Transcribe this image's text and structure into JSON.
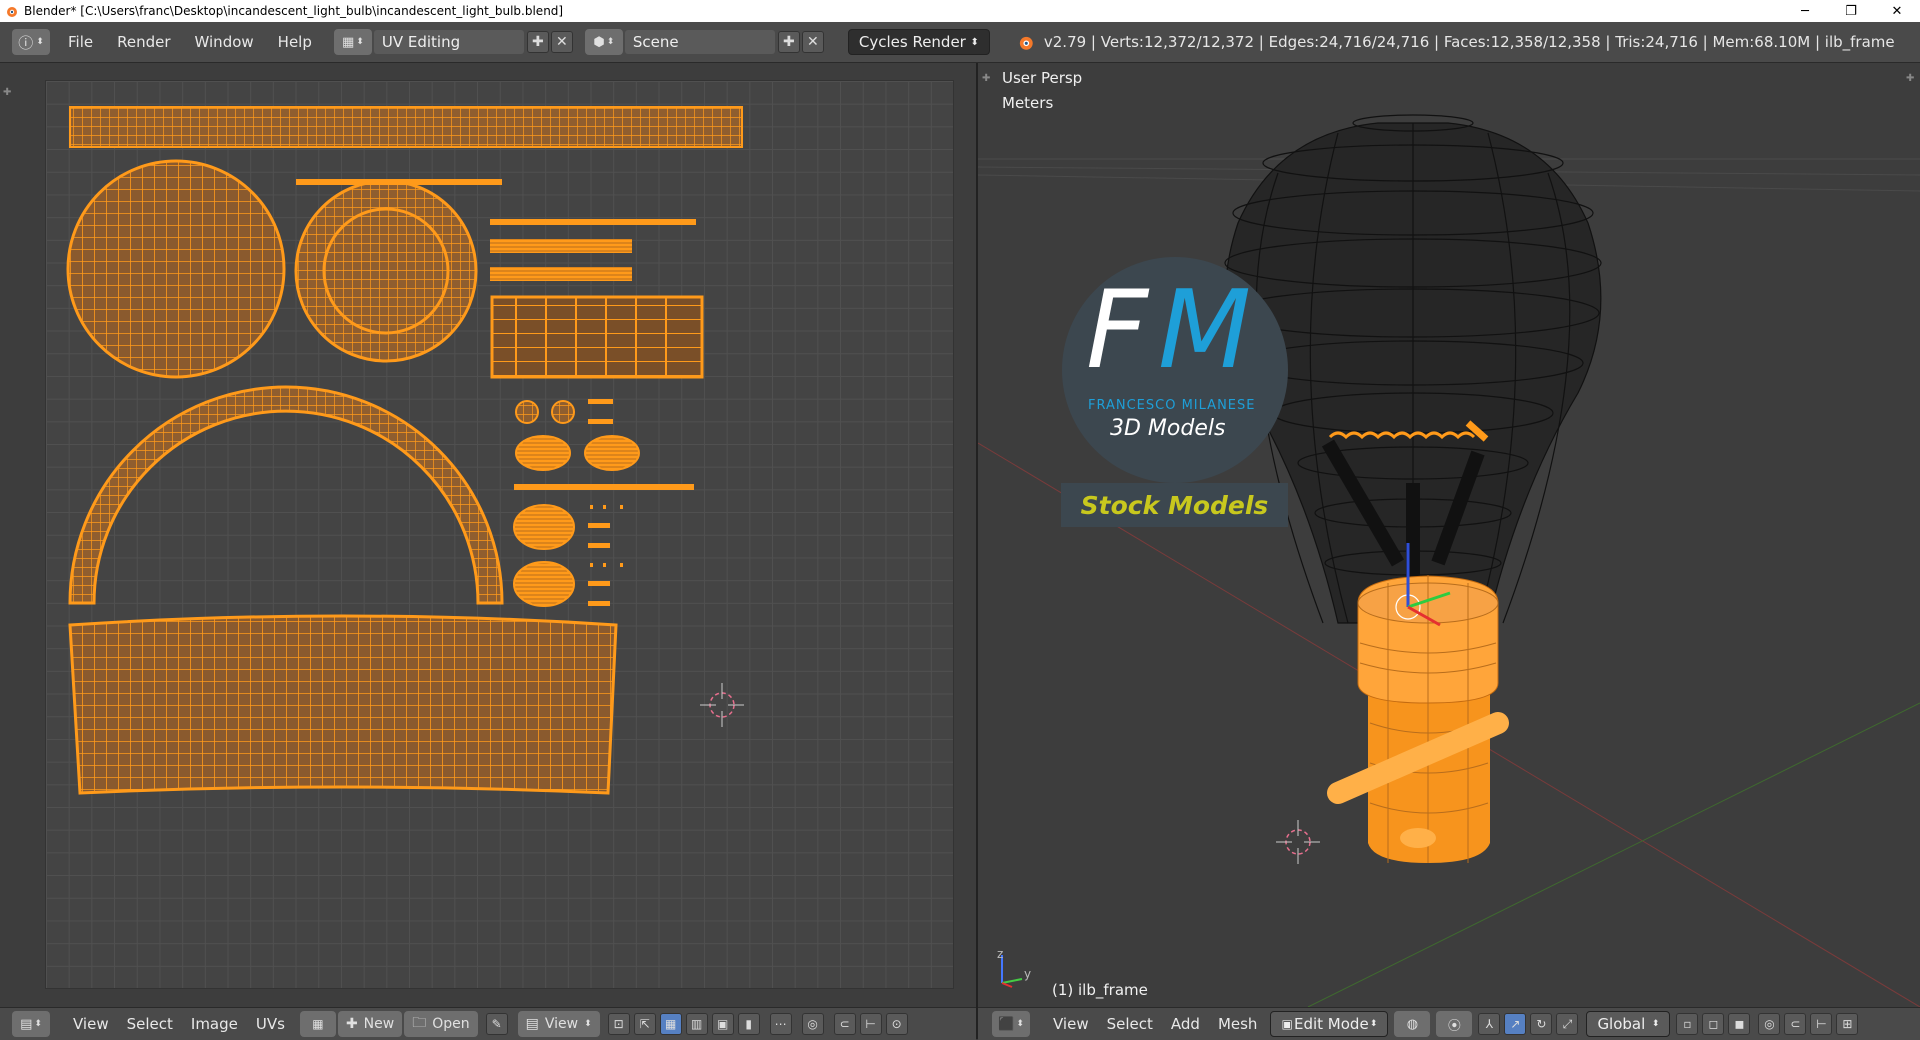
{
  "window": {
    "title": "Blender* [C:\\Users\\franc\\Desktop\\incandescent_light_bulb\\incandescent_light_bulb.blend]",
    "controls": [
      "─",
      "❐",
      "✕"
    ]
  },
  "menu": {
    "file": "File",
    "render": "Render",
    "window": "Window",
    "help": "Help"
  },
  "layout": {
    "value": "UV Editing"
  },
  "scene": {
    "value": "Scene"
  },
  "engine": {
    "value": "Cycles Render"
  },
  "stats": "v2.79 | Verts:12,372/12,372 | Edges:24,716/24,716 | Faces:12,358/12,358 | Tris:24,716 | Mem:68.10M | ilb_frame",
  "viewport": {
    "view_name": "User Persp",
    "units": "Meters",
    "object_label": "(1) ilb_frame",
    "axis_z": "z",
    "axis_y": "y"
  },
  "logo": {
    "initial_f": "F",
    "initial_m": "M",
    "name": "FRANCESCO MILANESE",
    "tagline": "3D Models",
    "badge": "Stock Models"
  },
  "uv_header": {
    "view": "View",
    "select": "Select",
    "image": "Image",
    "uvs": "UVs",
    "new": "New",
    "open": "Open",
    "view2": "View"
  },
  "vp_header": {
    "view": "View",
    "select": "Select",
    "add": "Add",
    "mesh": "Mesh",
    "mode": "Edit Mode",
    "orientation": "Global"
  },
  "colors": {
    "selection": "#ff9a1a",
    "wire": "#000000",
    "logo_blue": "#1e9fd8",
    "badge_text": "#c8c81e"
  }
}
